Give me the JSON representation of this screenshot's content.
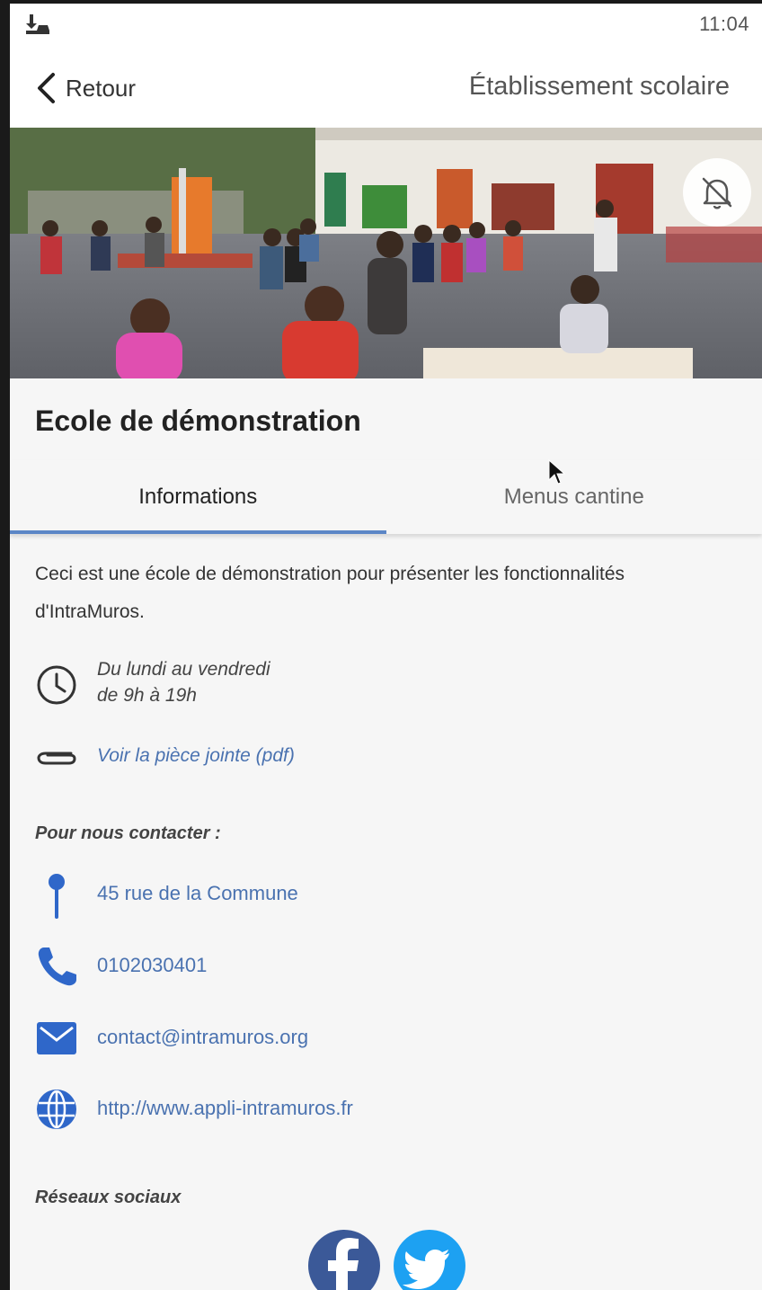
{
  "status_bar": {
    "time": "11:04",
    "notification_icon": "download-icon"
  },
  "nav": {
    "back_label": "Retour",
    "title": "Établissement scolaire"
  },
  "hero": {
    "image": "schoolyard-photo",
    "bell_icon": "bell-off-icon"
  },
  "school": {
    "name": "Ecole de démonstration"
  },
  "tabs": [
    {
      "label": "Informations",
      "active": true
    },
    {
      "label": "Menus cantine",
      "active": false
    }
  ],
  "description": "Ceci est une école de démonstration pour présenter les fonctionnalités d'IntraMuros.",
  "hours": {
    "line1": "Du lundi au vendredi",
    "line2": "de 9h à 19h",
    "icon": "clock-icon"
  },
  "attachment": {
    "label": "Voir la pièce jointe (pdf)",
    "icon": "paperclip-icon"
  },
  "contact": {
    "title": "Pour nous contacter :",
    "address": "45 rue de la Commune",
    "phone": "0102030401",
    "email": "contact@intramuros.org",
    "website": "http://www.appli-intramuros.fr"
  },
  "social": {
    "title": "Réseaux sociaux",
    "networks": [
      "facebook",
      "twitter"
    ]
  },
  "colors": {
    "accent": "#5b86c6",
    "link": "#4a72b0",
    "icon_blue": "#2f67c9"
  }
}
